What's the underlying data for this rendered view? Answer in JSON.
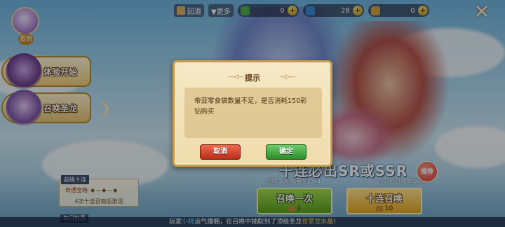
{
  "topbar": {
    "resource_icon": "crate-icon",
    "placeholder_chip": "回退",
    "more_label": "▼更多",
    "resources": [
      {
        "icon": "green-gem-icon",
        "value": "0",
        "color": "#4fb14b"
      },
      {
        "icon": "blue-gem-icon",
        "value": "28",
        "color": "#3a8ad8"
      },
      {
        "icon": "voucher-icon",
        "value": "0",
        "color": "#d4a247"
      }
    ],
    "plus": "+"
  },
  "close": "✕",
  "avatar": {
    "tag": "签到"
  },
  "sidebar": {
    "items": [
      {
        "label": "体验开始"
      },
      {
        "label": "召唤圣龙"
      }
    ]
  },
  "event": {
    "header": "超级十连",
    "badge": "奇遇宝箱",
    "dots": "◆—◆—◆",
    "note": "4次十连召唤后激活",
    "footer": "每日惊喜"
  },
  "banner": {
    "title": "十连必出SR或SSR",
    "sub_left": "召唤·1次·积累奖励×1",
    "sub_right": "今日已召唤 0/5000",
    "recommend": "推荐"
  },
  "summon": {
    "one": {
      "label": "召唤一次",
      "cost": "1"
    },
    "ten": {
      "label": "十连召唤",
      "cost": "10"
    }
  },
  "marquee": {
    "prefix": "玩家",
    "name": "小桃",
    "middle": "运气爆棚，在召唤中抽取到了顶级圣龙",
    "item": "苍翠龙水晶",
    "suffix": "!"
  },
  "modal": {
    "title": "提示",
    "deco_left": "—◁—",
    "deco_right": "—▷—",
    "message": "帝亚零食袋数量不足，是否消耗150彩钻购买",
    "cancel_label": "取消",
    "ok_label": "确定"
  }
}
